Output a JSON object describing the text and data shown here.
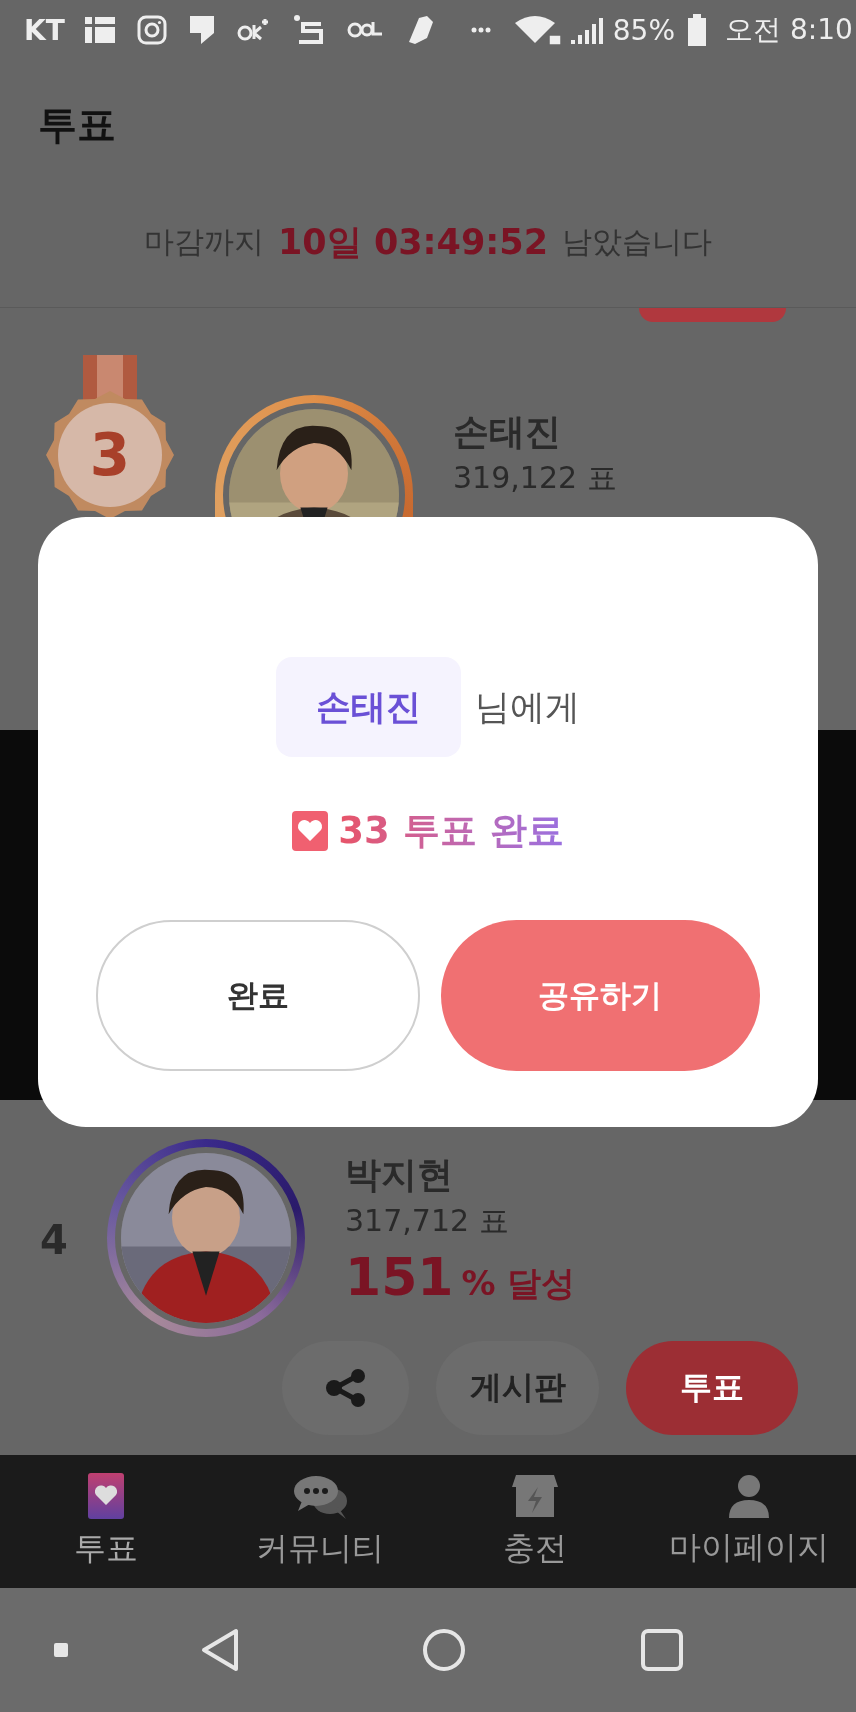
{
  "status_bar": {
    "carrier": "KT",
    "battery": "85%",
    "time": "오전 8:10"
  },
  "header": {
    "title": "투표"
  },
  "countdown": {
    "prefix": "마감까지",
    "remaining": "10일 03:49:52",
    "suffix": "남았습니다"
  },
  "candidates": [
    {
      "kind": "medal",
      "rank": "3",
      "name": "손태진",
      "votes": "319,122 표"
    },
    {
      "kind": "plain",
      "rank": "4",
      "name": "박지현",
      "votes": "317,712 표",
      "percent": "151",
      "percent_label": "% 달성",
      "actions": {
        "board": "게시판",
        "vote": "투표"
      }
    }
  ],
  "modal": {
    "recipient": "손태진",
    "recipient_suffix": "님에게",
    "result": "33 투표 완료",
    "buttons": [
      {
        "kind": "secondary",
        "label": "완료"
      },
      {
        "kind": "primary",
        "label": "공유하기"
      }
    ]
  },
  "bottom_nav": [
    {
      "kind": "vote",
      "label": "투표",
      "selected": true
    },
    {
      "kind": "community",
      "label": "커뮤니티",
      "selected": false
    },
    {
      "kind": "charge",
      "label": "충전",
      "selected": false
    },
    {
      "kind": "profile",
      "label": "마이페이지",
      "selected": false
    }
  ]
}
